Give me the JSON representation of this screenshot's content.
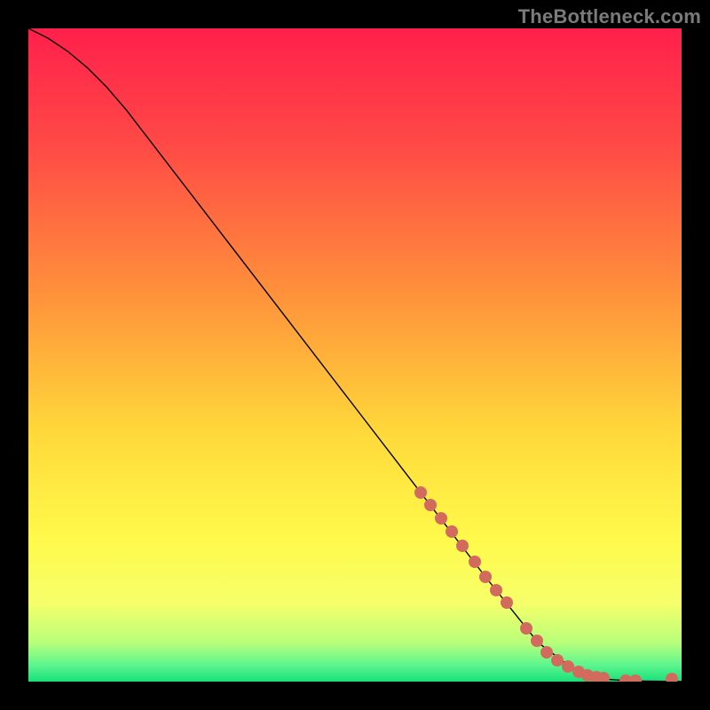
{
  "watermark": "TheBottleneck.com",
  "chart_data": {
    "type": "line",
    "title": "",
    "xlabel": "",
    "ylabel": "",
    "xlim": [
      0,
      100
    ],
    "ylim": [
      0,
      100
    ],
    "gradient_stops": [
      {
        "offset": 0,
        "color": "#ff1f4b"
      },
      {
        "offset": 0.18,
        "color": "#ff4a46"
      },
      {
        "offset": 0.4,
        "color": "#ff8f3b"
      },
      {
        "offset": 0.62,
        "color": "#ffd93a"
      },
      {
        "offset": 0.78,
        "color": "#fff94a"
      },
      {
        "offset": 0.88,
        "color": "#f6ff6a"
      },
      {
        "offset": 0.94,
        "color": "#b9ff7a"
      },
      {
        "offset": 0.975,
        "color": "#5cf58e"
      },
      {
        "offset": 1.0,
        "color": "#18e07a"
      }
    ],
    "series": [
      {
        "name": "curve",
        "color": "#000000",
        "width": 1.4,
        "x": [
          0,
          3,
          6,
          9,
          12,
          15,
          20,
          30,
          40,
          50,
          60,
          70,
          78,
          82,
          85,
          88,
          92,
          96,
          100
        ],
        "y": [
          100,
          98.5,
          96.5,
          94,
          91,
          87.5,
          81,
          68,
          55,
          42,
          29,
          16,
          6,
          3,
          1.2,
          0.4,
          0.1,
          0.05,
          0.02
        ]
      }
    ],
    "dots": {
      "name": "markers",
      "color": "#d36a5e",
      "radius": 7,
      "x": [
        60,
        61.6,
        63.2,
        64.8,
        66.4,
        68.4,
        70,
        71.6,
        73.2,
        76.2,
        77.8,
        79.4,
        81,
        82.6,
        84.2,
        85.6,
        87,
        88,
        91.5,
        93,
        98.5
      ],
      "y": [
        29,
        27,
        25,
        22.9,
        20.8,
        18.3,
        16,
        14,
        12.1,
        8.2,
        6.2,
        4.5,
        3.3,
        2.3,
        1.5,
        1.0,
        0.7,
        0.5,
        0.15,
        0.1,
        0.4
      ]
    }
  }
}
